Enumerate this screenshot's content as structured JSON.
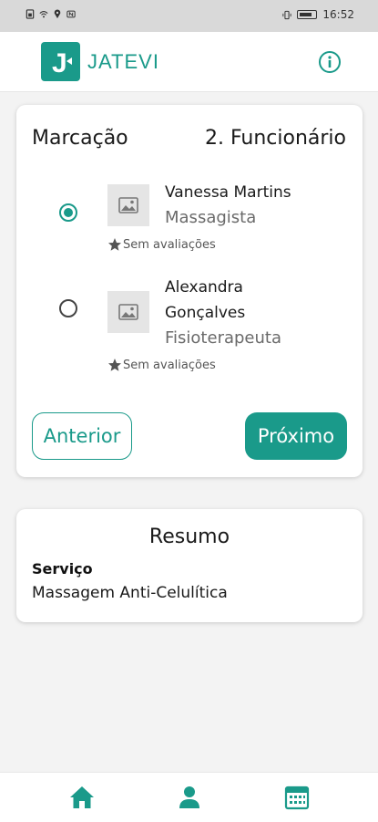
{
  "status_bar": {
    "time": "16:52",
    "icons": [
      "sim-icon",
      "wifi-icon",
      "location-icon",
      "nfc-icon",
      "vibrate-icon",
      "battery-icon"
    ]
  },
  "header": {
    "logo_letter": "J",
    "brand": "JATEVI",
    "info_icon": "info-icon"
  },
  "colors": {
    "accent": "#1a9a8a",
    "background": "#f3f3f3"
  },
  "booking": {
    "title": "Marcação",
    "step": "2. Funcionário",
    "employees": [
      {
        "name": "Vanessa Martins",
        "role": "Massagista",
        "rating": "Sem avaliações",
        "selected": true
      },
      {
        "name": "Alexandra Gonçalves",
        "role": "Fisioterapeuta",
        "rating": "Sem avaliações",
        "selected": false
      }
    ],
    "prev_label": "Anterior",
    "next_label": "Próximo"
  },
  "summary": {
    "title": "Resumo",
    "service_label": "Serviço",
    "service_value": "Massagem Anti-Celulítica"
  },
  "bottom_nav": {
    "items": [
      "home-icon",
      "person-icon",
      "calendar-icon"
    ]
  }
}
